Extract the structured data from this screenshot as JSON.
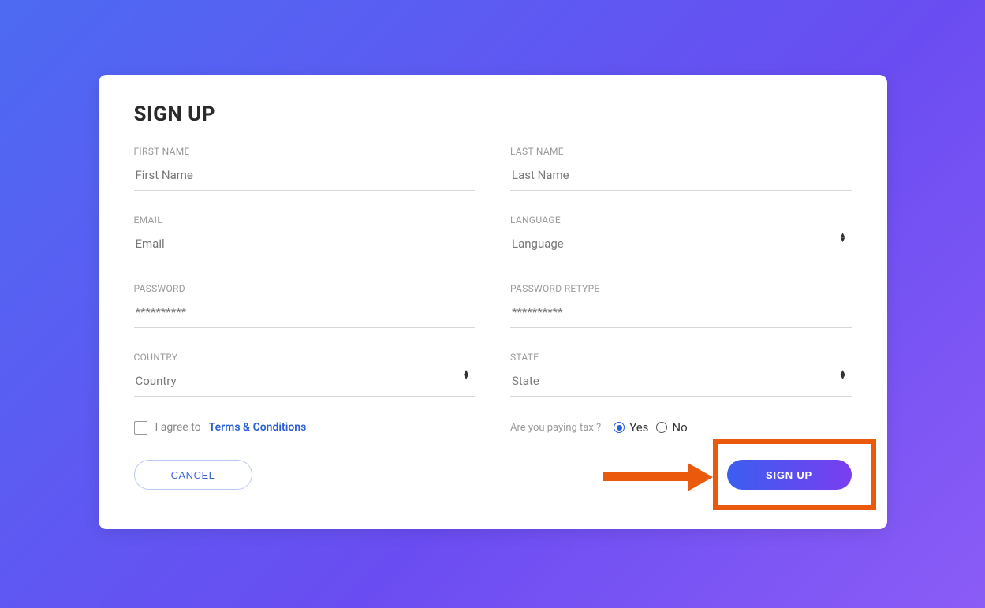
{
  "title": "SIGN UP",
  "fields": {
    "first_name": {
      "label": "FIRST NAME",
      "placeholder": "First Name"
    },
    "last_name": {
      "label": "LAST NAME",
      "placeholder": "Last Name"
    },
    "email": {
      "label": "EMAIL",
      "placeholder": "Email"
    },
    "language": {
      "label": "LANGUAGE",
      "placeholder": "Language"
    },
    "password": {
      "label": "PASSWORD",
      "placeholder": "**********"
    },
    "password_retype": {
      "label": "PASSWORD RETYPE",
      "placeholder": "**********"
    },
    "country": {
      "label": "COUNTRY",
      "placeholder": "Country"
    },
    "state": {
      "label": "STATE",
      "placeholder": "State"
    }
  },
  "agree": {
    "prefix": "I agree to",
    "link": "Terms & Conditions"
  },
  "tax": {
    "question": "Are you paying tax ?",
    "yes": "Yes",
    "no": "No",
    "selected": "yes"
  },
  "buttons": {
    "cancel": "CANCEL",
    "signup": "SIGN UP"
  },
  "annotation": {
    "highlight_target": "signup-button",
    "color": "#eb5a0c"
  }
}
